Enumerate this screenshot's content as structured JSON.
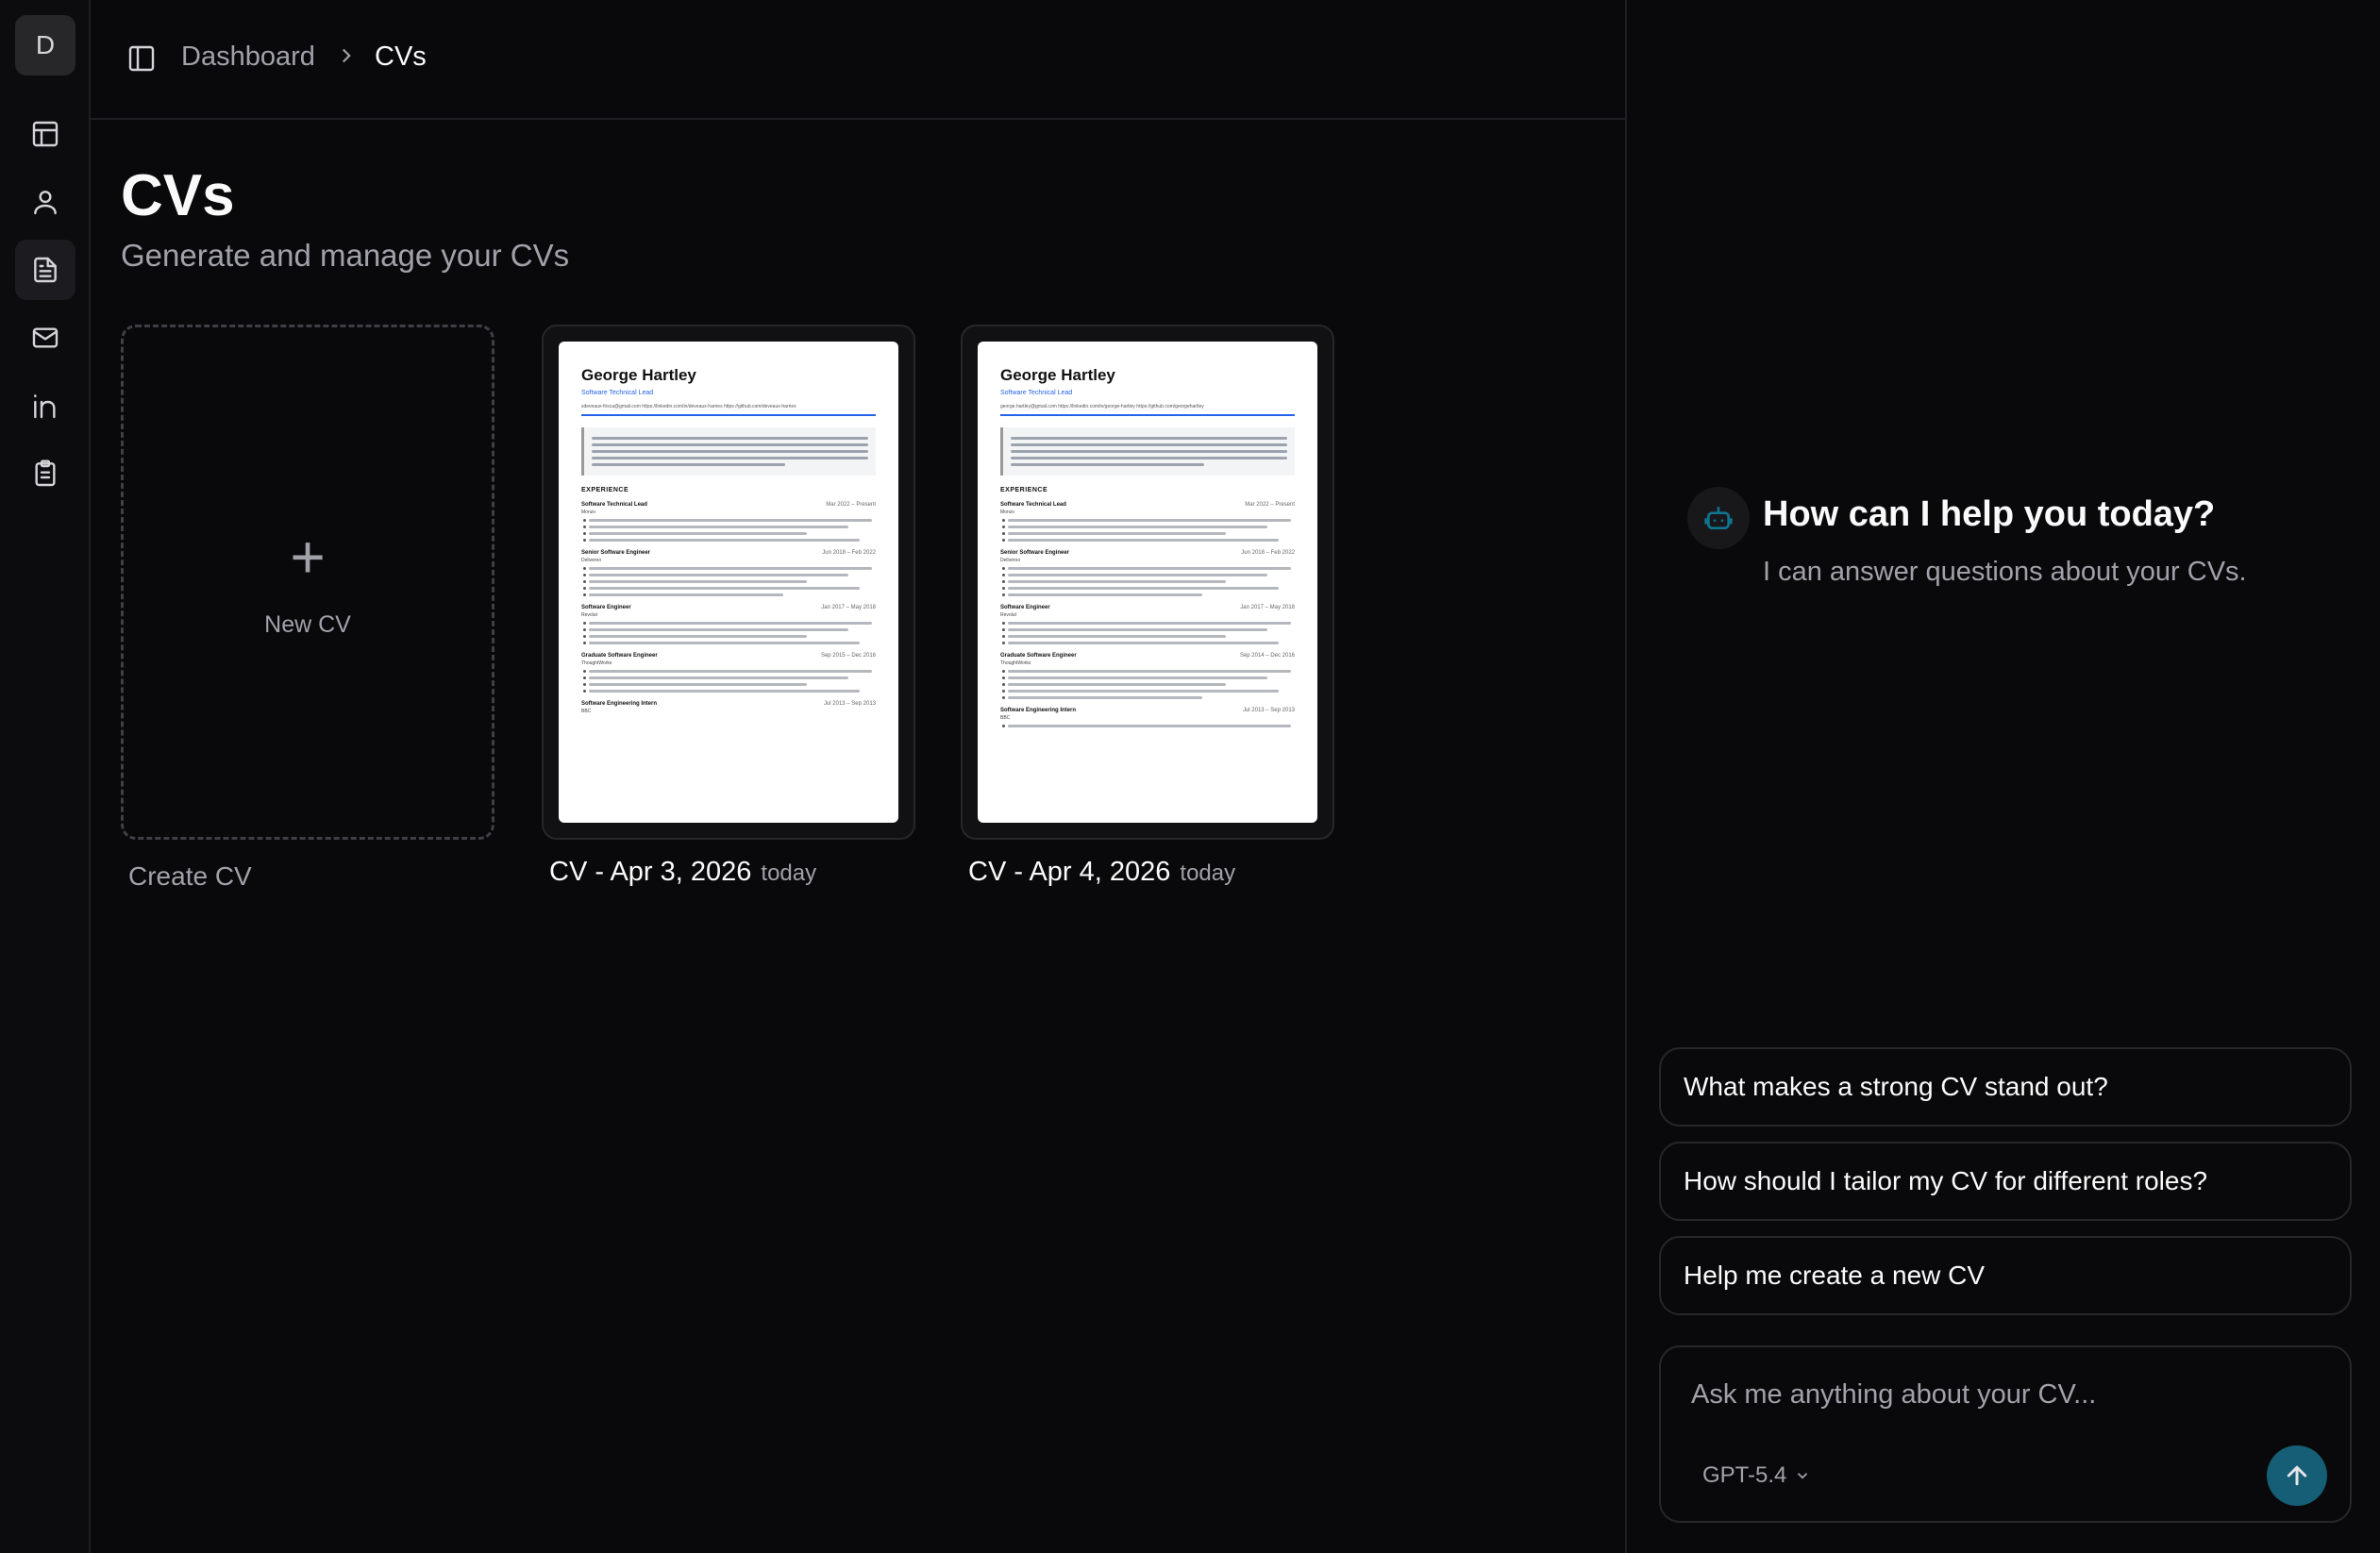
{
  "rail": {
    "avatar_initial": "D",
    "items": [
      {
        "icon": "dashboard-icon"
      },
      {
        "icon": "user-icon"
      },
      {
        "icon": "document-icon",
        "active": true
      },
      {
        "icon": "mail-icon"
      },
      {
        "icon": "linkedin-icon"
      },
      {
        "icon": "clipboard-icon"
      }
    ]
  },
  "header": {
    "breadcrumb": {
      "parent": "Dashboard",
      "current": "CVs"
    }
  },
  "page": {
    "title": "CVs",
    "subtitle": "Generate and manage your CVs"
  },
  "new_cv": {
    "card_label": "New CV",
    "caption": "Create CV"
  },
  "cvs": [
    {
      "title": "CV - Apr 3, 2026",
      "when": "today",
      "preview": {
        "name": "George Hartley",
        "role": "Software Technical Lead",
        "contact": "sdeveaux-frisca@gmail.com   https://linkedin.com/in/deveaux-harries   https://github.com/deveaux-harries",
        "section": "EXPERIENCE",
        "jobs": [
          {
            "title": "Software Technical Lead",
            "dates": "Mar 2022 – Present",
            "company": "Monzo",
            "bullets": 4
          },
          {
            "title": "Senior Software Engineer",
            "dates": "Jun 2018 – Feb 2022",
            "company": "Deliveroo",
            "bullets": 5
          },
          {
            "title": "Software Engineer",
            "dates": "Jan 2017 – May 2018",
            "company": "Revolut",
            "bullets": 4
          },
          {
            "title": "Graduate Software Engineer",
            "dates": "Sep 2015 – Dec 2016",
            "company": "ThoughtWorks",
            "bullets": 4
          },
          {
            "title": "Software Engineering Intern",
            "dates": "Jul 2013 – Sep 2013",
            "company": "BBC",
            "bullets": 0
          }
        ]
      }
    },
    {
      "title": "CV - Apr 4, 2026",
      "when": "today",
      "preview": {
        "name": "George Hartley",
        "role": "Software Technical Lead",
        "contact": "george.hartley@gmail.com   https://linkedin.com/in/george-hartley   https://github.com/georgehartley",
        "section": "EXPERIENCE",
        "jobs": [
          {
            "title": "Software Technical Lead",
            "dates": "Mar 2022 – Present",
            "company": "Monzo",
            "bullets": 4
          },
          {
            "title": "Senior Software Engineer",
            "dates": "Jun 2018 – Feb 2022",
            "company": "Deliveroo",
            "bullets": 5
          },
          {
            "title": "Software Engineer",
            "dates": "Jan 2017 – May 2018",
            "company": "Revolut",
            "bullets": 4
          },
          {
            "title": "Graduate Software Engineer",
            "dates": "Sep 2014 – Dec 2016",
            "company": "ThoughtWorks",
            "bullets": 5
          },
          {
            "title": "Software Engineering Intern",
            "dates": "Jul 2013 – Sep 2013",
            "company": "BBC",
            "bullets": 1
          }
        ]
      }
    }
  ],
  "chat": {
    "title": "How can I help you today?",
    "subtitle": "I can answer questions about your CVs.",
    "suggestions": [
      "What makes a strong CV stand out?",
      "How should I tailor my CV for different roles?",
      "Help me create a new CV"
    ],
    "input_placeholder": "Ask me anything about your CV...",
    "model": "GPT-5.4",
    "accent_color": "#155e75"
  }
}
